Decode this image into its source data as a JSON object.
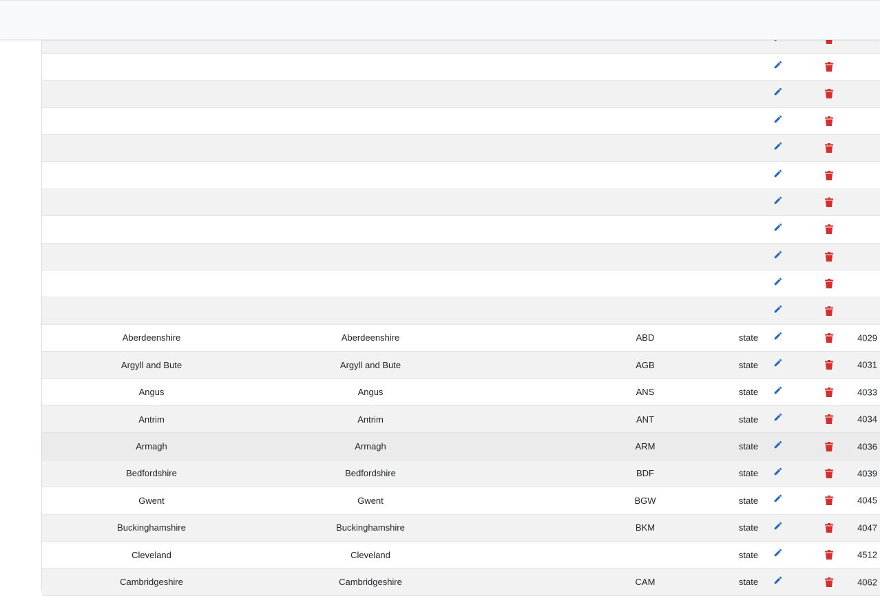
{
  "colors": {
    "edit_icon": "#2465c0",
    "delete_icon": "#d32f2f",
    "row_alt": "#f2f2f2"
  },
  "icons": {
    "edit": "pencil-icon",
    "delete": "trash-icon"
  },
  "blank_rows": 11,
  "rows": [
    {
      "name": "Aberdeenshire",
      "label": "Aberdeenshire",
      "code": "ABD",
      "type": "state",
      "id": "4029"
    },
    {
      "name": "Argyll and Bute",
      "label": "Argyll and Bute",
      "code": "AGB",
      "type": "state",
      "id": "4031"
    },
    {
      "name": "Angus",
      "label": "Angus",
      "code": "ANS",
      "type": "state",
      "id": "4033"
    },
    {
      "name": "Antrim",
      "label": "Antrim",
      "code": "ANT",
      "type": "state",
      "id": "4034"
    },
    {
      "name": "Armagh",
      "label": "Armagh",
      "code": "ARM",
      "type": "state",
      "id": "4036"
    },
    {
      "name": "Bedfordshire",
      "label": "Bedfordshire",
      "code": "BDF",
      "type": "state",
      "id": "4039"
    },
    {
      "name": "Gwent",
      "label": "Gwent",
      "code": "BGW",
      "type": "state",
      "id": "4045"
    },
    {
      "name": "Buckinghamshire",
      "label": "Buckinghamshire",
      "code": "BKM",
      "type": "state",
      "id": "4047"
    },
    {
      "name": "Cleveland",
      "label": "Cleveland",
      "code": "",
      "type": "state",
      "id": "4512"
    },
    {
      "name": "Cambridgeshire",
      "label": "Cambridgeshire",
      "code": "CAM",
      "type": "state",
      "id": "4062"
    }
  ]
}
